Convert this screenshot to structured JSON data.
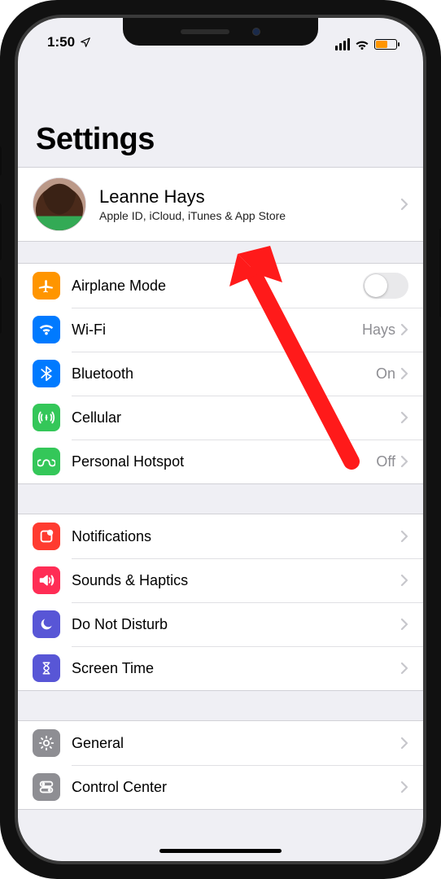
{
  "statusbar": {
    "time": "1:50"
  },
  "title": "Settings",
  "profile": {
    "name": "Leanne Hays",
    "subtitle": "Apple ID, iCloud, iTunes & App Store"
  },
  "group1": {
    "airplane": {
      "label": "Airplane Mode"
    },
    "wifi": {
      "label": "Wi-Fi",
      "value": "Hays"
    },
    "bluetooth": {
      "label": "Bluetooth",
      "value": "On"
    },
    "cellular": {
      "label": "Cellular"
    },
    "hotspot": {
      "label": "Personal Hotspot",
      "value": "Off"
    }
  },
  "group2": {
    "notifications": {
      "label": "Notifications"
    },
    "sounds": {
      "label": "Sounds & Haptics"
    },
    "dnd": {
      "label": "Do Not Disturb"
    },
    "screentime": {
      "label": "Screen Time"
    }
  },
  "group3": {
    "general": {
      "label": "General"
    },
    "controlcenter": {
      "label": "Control Center"
    }
  }
}
